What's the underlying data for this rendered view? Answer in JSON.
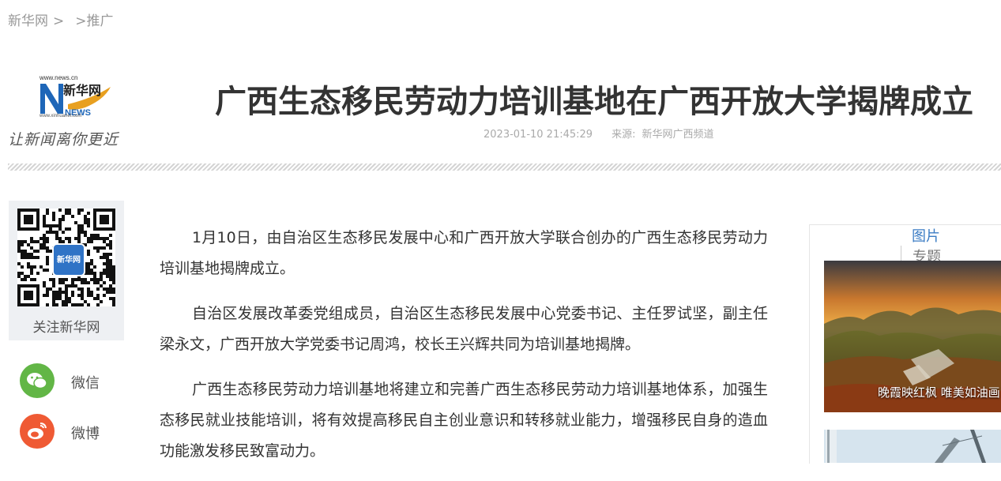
{
  "breadcrumb": {
    "home": "新华网",
    "sep1": ">",
    "sep2": ">",
    "section": "推广"
  },
  "logo": {
    "url_top": "www.news.cn",
    "brand": "新华网",
    "news": "NEWS",
    "url_bottom": "www.xinhuanet.com",
    "slogan": "让新闻离你更近"
  },
  "article": {
    "title": "广西生态移民劳动力培训基地在广西开放大学揭牌成立",
    "date": "2023-01-10 21:45:29",
    "source_label": "来源:",
    "source": "新华网广西频道",
    "paragraphs": [
      "1月10日，由自治区生态移民发展中心和广西开放大学联合创办的广西生态移民劳动力培训基地揭牌成立。",
      "自治区发展改革委党组成员，自治区生态移民发展中心党委书记、主任罗试坚，副主任梁永文，广西开放大学党委书记周鸿，校长王兴辉共同为培训基地揭牌。",
      "广西生态移民劳动力培训基地将建立和完善广西生态移民劳动力培训基地体系，加强生态移民就业技能培训，将有效提高移民自主创业意识和转移就业能力，增强移民自身的造血功能激发移民致富动力。"
    ]
  },
  "follow": {
    "qr_center": "新华网",
    "label": "关注新华网"
  },
  "share": {
    "wechat": "微信",
    "weibo": "微博"
  },
  "sidebar": {
    "tabs": [
      "图片",
      "专题"
    ],
    "pictures": [
      {
        "caption": "晚霞映红枫 唯美如油画"
      }
    ]
  },
  "colors": {
    "accent_blue": "#3b7cc4",
    "wechat_green": "#62b646",
    "weibo_red": "#ef5a34"
  }
}
